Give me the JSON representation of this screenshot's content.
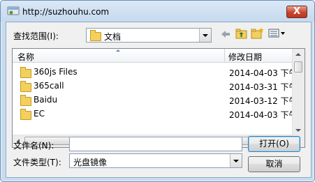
{
  "window": {
    "title": "http://suzhouhu.com",
    "close_label": "X"
  },
  "lookin": {
    "label": "查找范围(I):",
    "value": "文档"
  },
  "list": {
    "columns": [
      "名称",
      "修改日期"
    ],
    "rows": [
      {
        "name": "360js Files",
        "date": "2014-04-03 下午"
      },
      {
        "name": "365call",
        "date": "2014-03-31 下午"
      },
      {
        "name": "Baidu",
        "date": "2014-03-12 下午"
      },
      {
        "name": "EC",
        "date": "2014-04-03 下午"
      }
    ]
  },
  "filename": {
    "label": "文件名(N):",
    "value": ""
  },
  "filetype": {
    "label": "文件类型(T):",
    "value": "光盘镜像"
  },
  "buttons": {
    "open": "打开(O)",
    "cancel": "取消"
  },
  "icons": [
    "folder-icon",
    "back-icon",
    "up-folder-icon",
    "new-folder-icon",
    "view-menu-icon",
    "close-icon",
    "sort-indicator-icon"
  ]
}
